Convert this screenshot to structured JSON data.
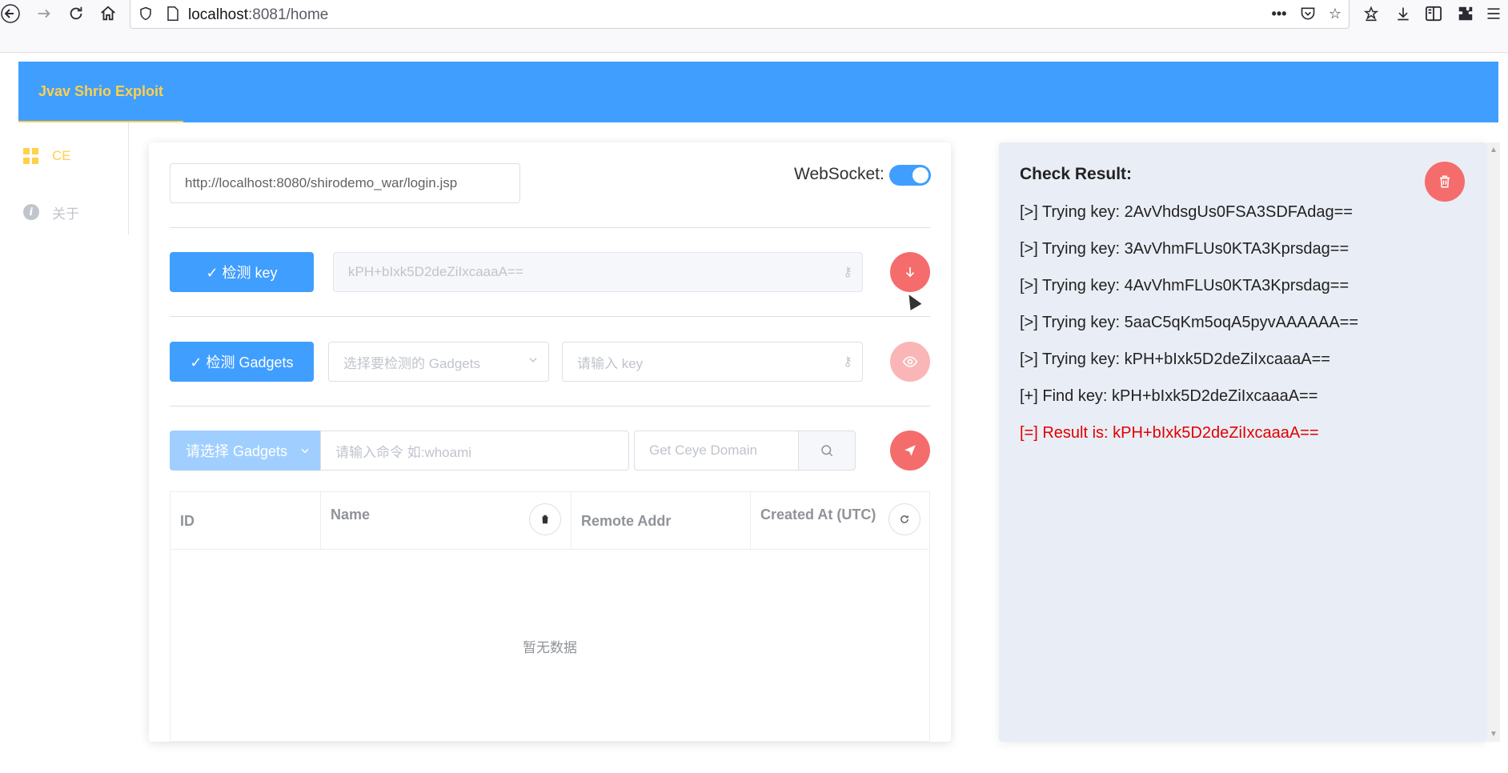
{
  "browser": {
    "url_host": "localhost",
    "url_rest": ":8081/home",
    "icons": [
      "back-icon",
      "forward-icon",
      "reload-icon",
      "home-icon",
      "shield-icon",
      "page-icon",
      "more-icon",
      "pocket-icon",
      "bookmark-star-icon",
      "library-icon",
      "download-icon",
      "sidebar-icon",
      "extensions-icon",
      "menu-icon"
    ]
  },
  "header": {
    "title": "Jvav Shrio Exploit",
    "accent": "#ffd04b",
    "bg": "#409eff"
  },
  "sidebar": {
    "items": [
      {
        "label": "CE",
        "icon": "grid-icon"
      },
      {
        "label": "关于",
        "icon": "info-icon"
      }
    ]
  },
  "main": {
    "target_url": "http://localhost:8080/shirodemo_war/login.jsp",
    "websocket_label": "WebSocket:",
    "websocket_on": true,
    "check_key_button": "✓ 检测 key",
    "found_key": "kPH+bIxk5D2deZiIxcaaaA==",
    "check_gadgets_button": "✓ 检测 Gadgets",
    "gadgets_select_placeholder": "选择要检测的 Gadgets",
    "key_input_placeholder": "请输入 key",
    "exec_gadget_select": "请选择 Gadgets",
    "command_placeholder": "请输入命令 如:whoami",
    "ceye_placeholder": "Get Ceye Domain",
    "table": {
      "columns": [
        "ID",
        "Name",
        "Remote Addr",
        "Created At (UTC)"
      ],
      "empty_text": "暂无数据"
    }
  },
  "result": {
    "title": "Check Result:",
    "lines": [
      {
        "text": "[>] Trying key: 2AvVhdsgUs0FSA3SDFAdag==",
        "color": "#222222"
      },
      {
        "text": "[>] Trying key: 3AvVhmFLUs0KTA3Kprsdag==",
        "color": "#222222"
      },
      {
        "text": "[>] Trying key: 4AvVhmFLUs0KTA3Kprsdag==",
        "color": "#222222"
      },
      {
        "text": "[>] Trying key: 5aaC5qKm5oqA5pyvAAAAAA==",
        "color": "#222222"
      },
      {
        "text": "[>] Trying key: kPH+bIxk5D2deZiIxcaaaA==",
        "color": "#222222"
      },
      {
        "text": "[+] Find key: kPH+bIxk5D2deZiIxcaaaA==",
        "color": "#222222"
      },
      {
        "text": "[=] Result is: kPH+bIxk5D2deZiIxcaaaA==",
        "color": "#e00000"
      }
    ]
  }
}
